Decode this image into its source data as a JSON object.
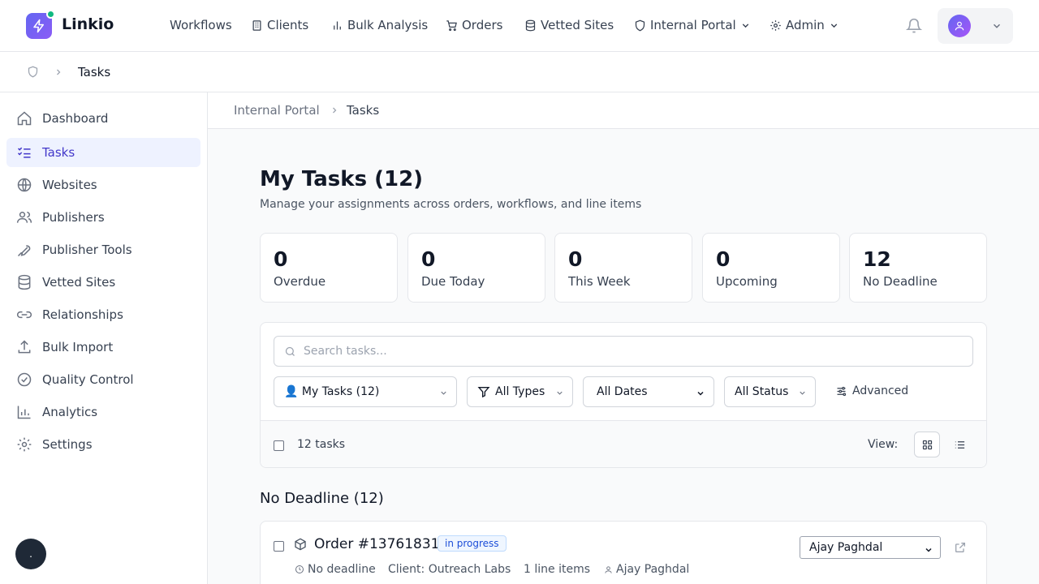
{
  "brand": {
    "name": "Linkio"
  },
  "topnav": {
    "items": [
      {
        "label": "Workflows",
        "icon": "none"
      },
      {
        "label": "Clients",
        "icon": "building-icon"
      },
      {
        "label": "Bulk Analysis",
        "icon": "bar-chart-icon"
      },
      {
        "label": "Orders",
        "icon": "cart-icon"
      },
      {
        "label": "Vetted Sites",
        "icon": "database-icon"
      },
      {
        "label": "Internal Portal",
        "icon": "shield-icon"
      },
      {
        "label": "Admin",
        "icon": "gear-icon"
      }
    ]
  },
  "breadcrumb": {
    "current": "Tasks"
  },
  "sidebar": {
    "items": [
      {
        "label": "Dashboard",
        "icon": "home-icon"
      },
      {
        "label": "Tasks",
        "icon": "list-checks-icon",
        "active": true
      },
      {
        "label": "Websites",
        "icon": "globe-icon"
      },
      {
        "label": "Publishers",
        "icon": "users-icon"
      },
      {
        "label": "Publisher Tools",
        "icon": "wrench-icon"
      },
      {
        "label": "Vetted Sites",
        "icon": "database-icon"
      },
      {
        "label": "Relationships",
        "icon": "link-icon"
      },
      {
        "label": "Bulk Import",
        "icon": "upload-icon"
      },
      {
        "label": "Quality Control",
        "icon": "check-circle-icon"
      },
      {
        "label": "Analytics",
        "icon": "bar-chart-icon"
      },
      {
        "label": "Settings",
        "icon": "gear-icon"
      }
    ]
  },
  "main": {
    "breadcrumb": {
      "parent": "Internal Portal",
      "current": "Tasks"
    },
    "title": "My Tasks (12)",
    "subtitle": "Manage your assignments across orders, workflows, and line items",
    "stats": [
      {
        "value": "0",
        "label": "Overdue"
      },
      {
        "value": "0",
        "label": "Due Today"
      },
      {
        "value": "0",
        "label": "This Week"
      },
      {
        "value": "0",
        "label": "Upcoming"
      },
      {
        "value": "12",
        "label": "No Deadline"
      }
    ],
    "filters": {
      "search_placeholder": "Search tasks...",
      "assignee": "👤 My Tasks (12)",
      "types": "All Types",
      "dates": "All Dates",
      "status": "All Status",
      "advanced": "Advanced"
    },
    "bulk": {
      "count": "12 tasks",
      "view_label": "View:"
    },
    "section_title": "No Deadline (12)",
    "tasks": [
      {
        "title": "Order #13761831",
        "status": "in progress",
        "deadline": "No deadline",
        "client": "Client: Outreach Labs",
        "items": "1 line items",
        "assignee": "Ajay Paghdal",
        "assignee_select": "Ajay Paghdal"
      }
    ]
  },
  "colors": {
    "accent": "#4338ca",
    "brand_gradient_start": "#6366f1",
    "status_dot": "#10b981"
  }
}
